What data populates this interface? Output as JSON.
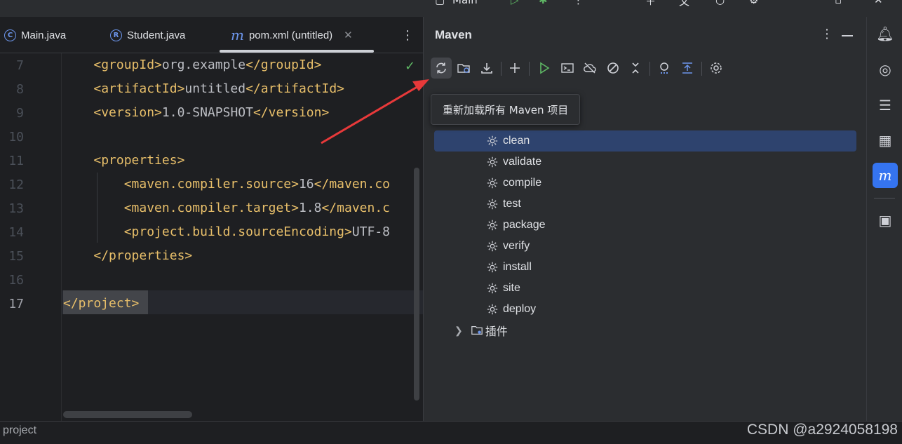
{
  "topbar": {
    "run_config": "Main"
  },
  "editor": {
    "tabs": [
      {
        "label": "Main.java",
        "icon": "C"
      },
      {
        "label": "Student.java",
        "icon": "R"
      },
      {
        "label": "pom.xml (untitled)",
        "icon": "m"
      }
    ],
    "line_numbers": [
      "7",
      "8",
      "9",
      "10",
      "11",
      "12",
      "13",
      "14",
      "15",
      "16",
      "17"
    ],
    "lines": [
      {
        "indent": "    ",
        "open": "<groupId>",
        "text": "org.example",
        "close": "</groupId>"
      },
      {
        "indent": "    ",
        "open": "<artifactId>",
        "text": "untitled",
        "close": "</artifactId>"
      },
      {
        "indent": "    ",
        "open": "<version>",
        "text": "1.0-SNAPSHOT",
        "close": "</version>"
      },
      {
        "indent": "",
        "open": "",
        "text": "",
        "close": ""
      },
      {
        "indent": "    ",
        "open": "<properties>",
        "text": "",
        "close": ""
      },
      {
        "indent": "        ",
        "open": "<maven.compiler.source>",
        "text": "16",
        "close": "</maven.co"
      },
      {
        "indent": "        ",
        "open": "<maven.compiler.target>",
        "text": "1.8",
        "close": "</maven.c"
      },
      {
        "indent": "        ",
        "open": "<project.build.sourceEncoding>",
        "text": "UTF-8",
        "close": ""
      },
      {
        "indent": "    ",
        "open": "</properties>",
        "text": "",
        "close": ""
      },
      {
        "indent": "",
        "open": "",
        "text": "",
        "close": ""
      },
      {
        "indent": "",
        "open": "</project>",
        "text": "",
        "close": ""
      }
    ]
  },
  "status": {
    "path": "project",
    "watermark": "CSDN @a2924058198"
  },
  "maven": {
    "title": "Maven",
    "tooltip": "重新加载所有 Maven 项目",
    "lifecycle": [
      "clean",
      "validate",
      "compile",
      "test",
      "package",
      "verify",
      "install",
      "site",
      "deploy"
    ],
    "plugins_label": "插件"
  },
  "colors": {
    "accent": "#3574f0",
    "selection": "#2e436e",
    "arrow": "#e8393a",
    "xml_tag": "#e8bf6a"
  }
}
